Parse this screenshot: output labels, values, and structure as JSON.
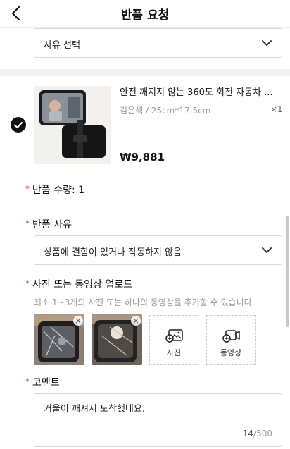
{
  "header": {
    "title": "반품 요청",
    "back_icon": "chevron-left-icon"
  },
  "reason_select_top": {
    "value": "사유 선택"
  },
  "product": {
    "name": "안전 깨지지 않는 360도 회전 자동차 ...",
    "variant": "검은색 / 25cm*17.5cm",
    "quantity": "×1",
    "price": "₩9,881",
    "selected": true
  },
  "return_qty": {
    "label": "반품 수량: 1"
  },
  "return_reason": {
    "label": "반품 사유",
    "value": "상품에 결함이 있거나 작동하지 않음"
  },
  "upload": {
    "label": "사진 또는 동영상 업로드",
    "hint": "최소 1~3개의 사진 또는 하나의 동영상을 추가할 수 있습니다.",
    "remove_glyph": "×",
    "add_photo": "사진",
    "add_video": "동영상"
  },
  "comment": {
    "label": "코멘트",
    "value": "거울이 깨져서 도착했네요.",
    "count": "14",
    "max": "/500"
  },
  "colors": {
    "required": "#e03b2f",
    "hint": "#999999",
    "border": "#d8d8d8"
  }
}
